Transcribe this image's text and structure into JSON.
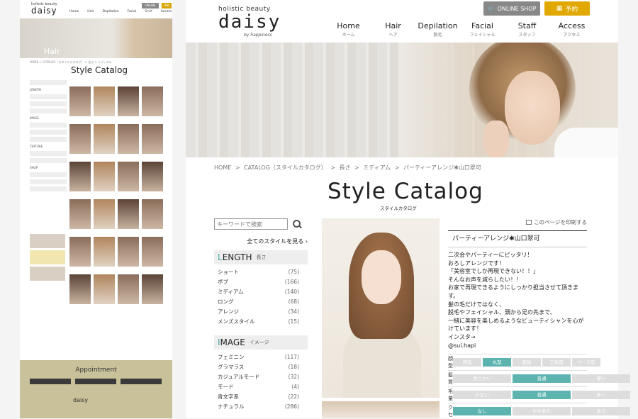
{
  "thumb": {
    "logo_small": "holistic beauty",
    "logo": "daisy",
    "nav": [
      "Home",
      "Hair",
      "Depilation",
      "Facial",
      "Staff",
      "Access"
    ],
    "shop": "ONLINE SHOP",
    "reserve": "予約",
    "hero_label": "Hair",
    "crumb": "HOME > CATALOG（スタイルカタログ） > 長さ > ミディアム",
    "title": "Style Catalog",
    "side_items": [
      "LENGTH",
      "IMAGE",
      "TEXTURE",
      "SHOP"
    ],
    "appointment": "Appointment",
    "footer_logo": "daisy"
  },
  "header": {
    "logo_small": "holistic beauty",
    "logo": "daisy",
    "logo_sub": "by happiness",
    "shop_button": "ONLINE SHOP",
    "reserve_button": "予約",
    "nav": [
      {
        "en": "Home",
        "jp": "ホーム"
      },
      {
        "en": "Hair",
        "jp": "ヘア"
      },
      {
        "en": "Depilation",
        "jp": "脱毛"
      },
      {
        "en": "Facial",
        "jp": "フェイシャル"
      },
      {
        "en": "Staff",
        "jp": "スタッフ"
      },
      {
        "en": "Access",
        "jp": "アクセス"
      }
    ]
  },
  "breadcrumb": [
    "HOME",
    ">",
    "CATALOG（スタイルカタログ）",
    ">",
    "長さ",
    ">",
    "ミディアム",
    ">",
    "パーティーアレンジ✱山口翠可"
  ],
  "page": {
    "title": "Style Catalog",
    "subtitle": "スタイルカタログ"
  },
  "sidebar": {
    "search_placeholder": "キーワードで検索",
    "all_styles": "全てのスタイルを見る ›",
    "length": {
      "head_first": "L",
      "head_rest": "ENGTH",
      "head_jp": "長さ",
      "items": [
        {
          "label": "ショート",
          "count": "(75)"
        },
        {
          "label": "ボブ",
          "count": "(166)"
        },
        {
          "label": "ミディアム",
          "count": "(140)"
        },
        {
          "label": "ロング",
          "count": "(68)"
        },
        {
          "label": "アレンジ",
          "count": "(34)"
        },
        {
          "label": "メンズスタイル",
          "count": "(15)"
        }
      ]
    },
    "image": {
      "head_first": "I",
      "head_rest": "MAGE",
      "head_jp": "イメージ",
      "items": [
        {
          "label": "フェミニン",
          "count": "(117)"
        },
        {
          "label": "グラマラス",
          "count": "(18)"
        },
        {
          "label": "カジュアルモード",
          "count": "(32)"
        },
        {
          "label": "モード",
          "count": "(4)"
        },
        {
          "label": "青文字系",
          "count": "(22)"
        },
        {
          "label": "ナチュラル",
          "count": "(286)"
        }
      ]
    }
  },
  "detail": {
    "print": "このページを印刷する",
    "style_name": "パーティーアレンジ✱山口翠可",
    "description": "二次会やパーティーにピッタリ！\nおろしアレンジです！\n「美容室でしか再現できない！！」\nそんなお声を減らしたい！！\nお家で再現できるようにしっかり担当させて頂きます。\n髪の毛だけではなく、\n脱毛やフェイシャル、頭から足の先まで、\n一緒に美容を楽しめるようなビューティシャンを心がけています！\nインスタ→\n@sui.hapi",
    "attributes": [
      {
        "label": "顔型",
        "options": [
          "卵型",
          "丸型",
          "面長",
          "三角型",
          "ベース型"
        ],
        "selected": 1
      },
      {
        "label": "髪質",
        "options": [
          "柔らかい",
          "普通",
          "硬い"
        ],
        "selected": 1
      },
      {
        "label": "毛量",
        "options": [
          "少ない",
          "普通",
          "多い"
        ],
        "selected": 1
      },
      {
        "label": "クセ",
        "options": [
          "なし",
          "ややあり",
          "あり"
        ],
        "selected": 0
      }
    ]
  },
  "colors": {
    "accent": "#5cb3b0",
    "reserve": "#e0a800",
    "shop": "#888888"
  }
}
